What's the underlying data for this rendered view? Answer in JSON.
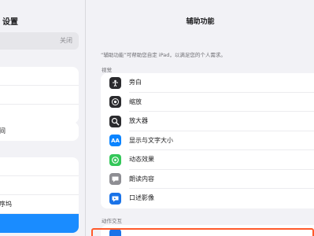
{
  "sidebar": {
    "title": "设置",
    "search_right": "关闭",
    "groups": [
      [
        "",
        "",
        ""
      ],
      [
        "间"
      ],
      [
        "",
        "",
        "序坞",
        ""
      ]
    ]
  },
  "main": {
    "title": "辅助功能",
    "description": "“辅助功能”可帮助您自定 iPad，以满足您的个人需求。",
    "section_vision": "视觉",
    "vision_items": [
      {
        "label": "旁白",
        "icon": "voiceover-icon",
        "color": "#2b2b2e"
      },
      {
        "label": "缩放",
        "icon": "zoom-icon",
        "color": "#2b2b2e"
      },
      {
        "label": "放大器",
        "icon": "magnifier-icon",
        "color": "#2b2b2e"
      },
      {
        "label": "显示与文字大小",
        "icon": "text-size-icon",
        "color": "#0a84ff"
      },
      {
        "label": "动态效果",
        "icon": "motion-icon",
        "color": "#34c759"
      },
      {
        "label": "朗读内容",
        "icon": "speech-bubble-icon",
        "color": "#8e8e93"
      },
      {
        "label": "口述影像",
        "icon": "audio-description-icon",
        "color": "#1a73e8"
      }
    ],
    "section_interaction": "动作交互"
  }
}
